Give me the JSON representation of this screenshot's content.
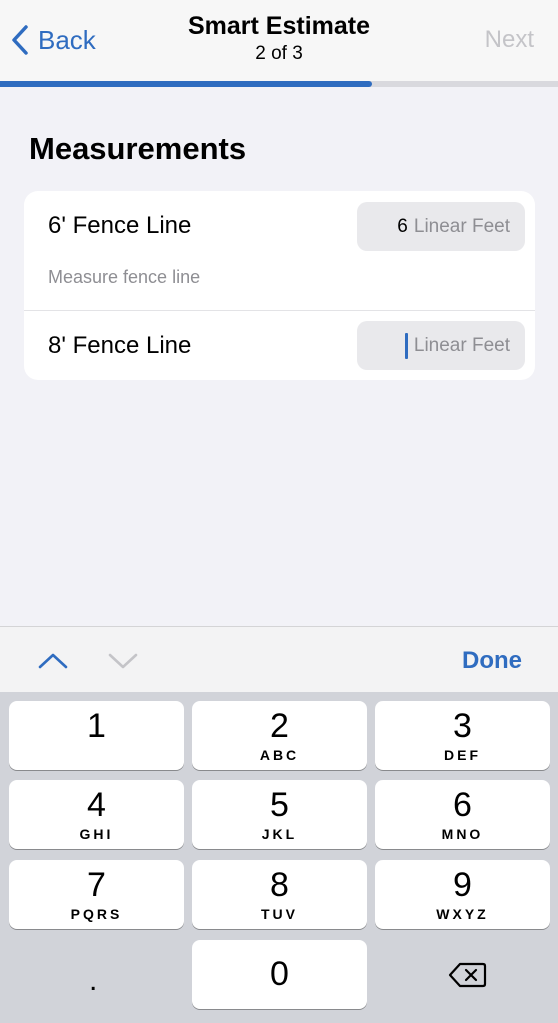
{
  "nav": {
    "back_label": "Back",
    "title": "Smart Estimate",
    "subtitle": "2 of 3",
    "next_label": "Next"
  },
  "progress": {
    "fraction": 0.667
  },
  "section": {
    "title": "Measurements"
  },
  "rows": [
    {
      "label": "6' Fence Line",
      "value": "6",
      "unit": "Linear Feet",
      "hint": "Measure fence line"
    },
    {
      "label": "8' Fence Line",
      "value": "",
      "unit": "Linear Feet"
    }
  ],
  "toolbar": {
    "done_label": "Done"
  },
  "keypad": {
    "keys": [
      {
        "num": "1",
        "letters": ""
      },
      {
        "num": "2",
        "letters": "ABC"
      },
      {
        "num": "3",
        "letters": "DEF"
      },
      {
        "num": "4",
        "letters": "GHI"
      },
      {
        "num": "5",
        "letters": "JKL"
      },
      {
        "num": "6",
        "letters": "MNO"
      },
      {
        "num": "7",
        "letters": "PQRS"
      },
      {
        "num": "8",
        "letters": "TUV"
      },
      {
        "num": "9",
        "letters": "WXYZ"
      },
      {
        "num": "0",
        "letters": ""
      }
    ],
    "decimal": ".",
    "colors": {
      "accent": "#2f6cc0",
      "keyboard_bg": "#d1d3d9"
    }
  }
}
